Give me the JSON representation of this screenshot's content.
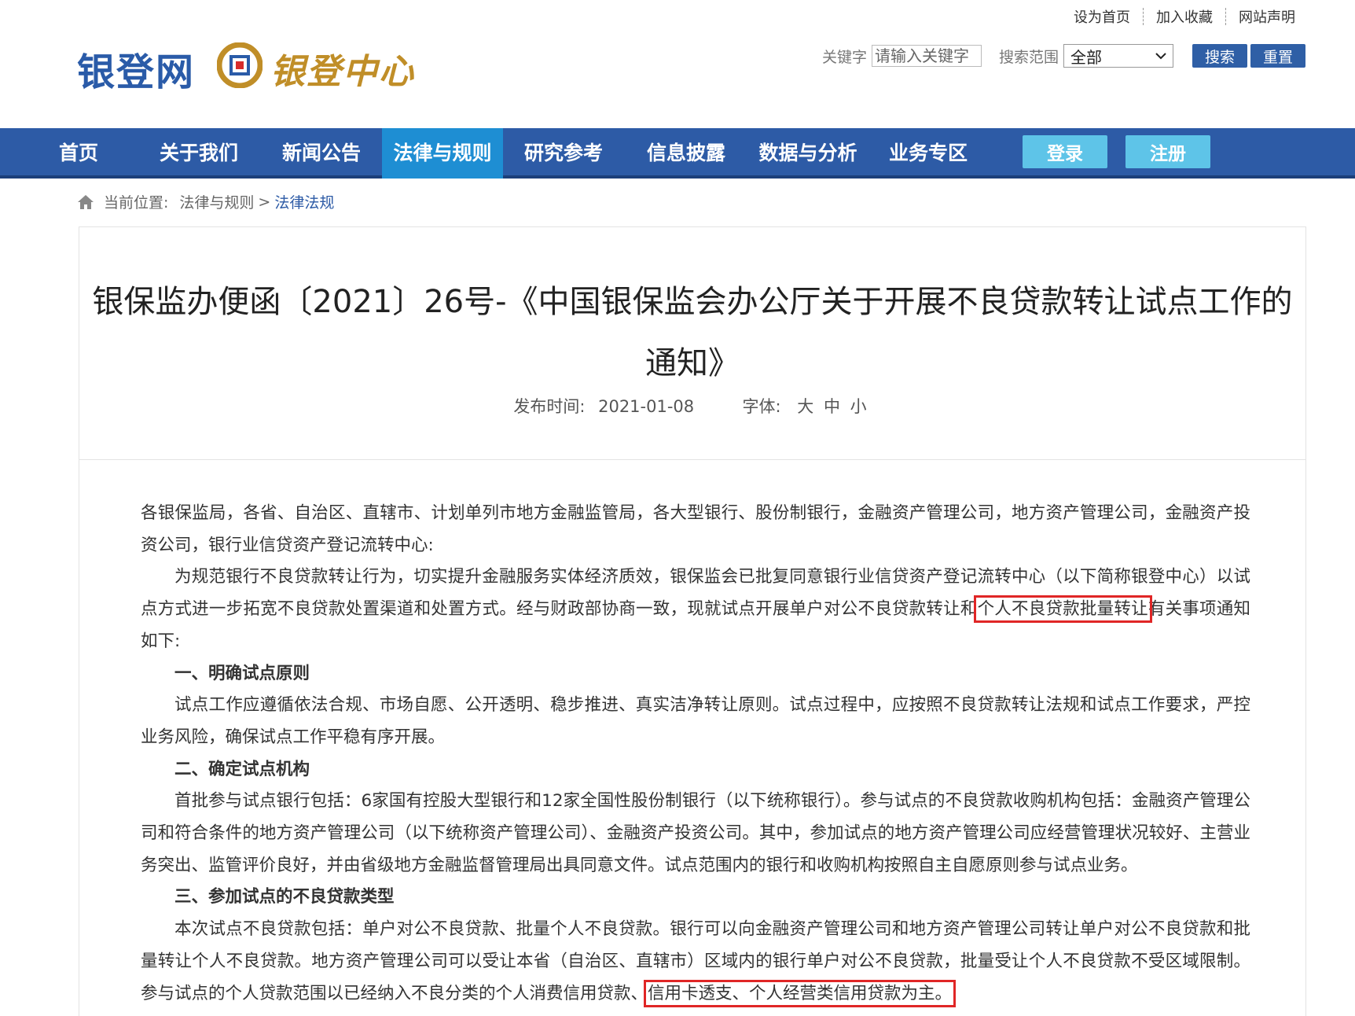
{
  "toplinks": [
    "设为首页",
    "加入收藏",
    "网站声明"
  ],
  "logo": {
    "site_name": "银登网",
    "center_name": "银登中心"
  },
  "search": {
    "keyword_label": "关键字",
    "keyword_placeholder": "请输入关键字",
    "scope_label": "搜索范围",
    "scope_selected": "全部",
    "search_button": "搜索",
    "reset_button": "重置"
  },
  "nav": {
    "items": [
      "首页",
      "关于我们",
      "新闻公告",
      "法律与规则",
      "研究参考",
      "信息披露",
      "数据与分析",
      "业务专区"
    ],
    "active": "法律与规则",
    "login": "登录",
    "register": "注册"
  },
  "breadcrumb": {
    "label": "当前位置:",
    "parent": "法律与规则",
    "separator": ">",
    "current": "法律法规"
  },
  "article": {
    "title": "银保监办便函〔2021〕26号-《中国银保监会办公厅关于开展不良贷款转让试点工作的通知》",
    "date_label": "发布时间:",
    "date": "2021-01-08",
    "font_label": "字体:",
    "font_sizes": [
      "大",
      "中",
      "小"
    ],
    "addressee": "各银保监局，各省、自治区、直辖市、计划单列市地方金融监管局，各大型银行、股份制银行，金融资产管理公司，地方资产管理公司，金融资产投资公司，银行业信贷资产登记流转中心:",
    "p1_a": "为规范银行不良贷款转让行为，切实提升金融服务实体经济质效，银保监会已批复同意银行业信贷资产登记流转中心（以下简称银登中心）以试点方式进一步拓宽不良贷款处置渠道和处置方式。经与财政部协商一致，现就试点开展单户对公不良贷款转让和",
    "p1_hl": "个人不良贷款批量转让",
    "p1_b": "有关事项通知如下:",
    "s1": "一、明确试点原则",
    "s1_body": "试点工作应遵循依法合规、市场自愿、公开透明、稳步推进、真实洁净转让原则。试点过程中，应按照不良贷款转让法规和试点工作要求，严控业务风险，确保试点工作平稳有序开展。",
    "s2": "二、确定试点机构",
    "s2_body": "首批参与试点银行包括：6家国有控股大型银行和12家全国性股份制银行（以下统称银行）。参与试点的不良贷款收购机构包括：金融资产管理公司和符合条件的地方资产管理公司（以下统称资产管理公司）、金融资产投资公司。其中，参加试点的地方资产管理公司应经营管理状况较好、主营业务突出、监管评价良好，并由省级地方金融监督管理局出具同意文件。试点范围内的银行和收购机构按照自主自愿原则参与试点业务。",
    "s3": "三、参加试点的不良贷款类型",
    "s3_body_a": "本次试点不良贷款包括：单户对公不良贷款、批量个人不良贷款。银行可以向金融资产管理公司和地方资产管理公司转让单户对公不良贷款和批量转让个人不良贷款。地方资产管理公司可以受让本省（自治区、直辖市）区域内的银行单户对公不良贷款，批量受让个人不良贷款不受区域限制。参与试点的个人贷款范围以已经纳入不良分类的个人消费信用贷款、",
    "s3_body_hl": "信用卡透支、个人经营类信用贷款为主。"
  },
  "colors": {
    "nav": "#2d5ba6",
    "nav_active": "#1e8ed3",
    "button_light": "#5ec4e8",
    "highlight": "#e02626"
  }
}
